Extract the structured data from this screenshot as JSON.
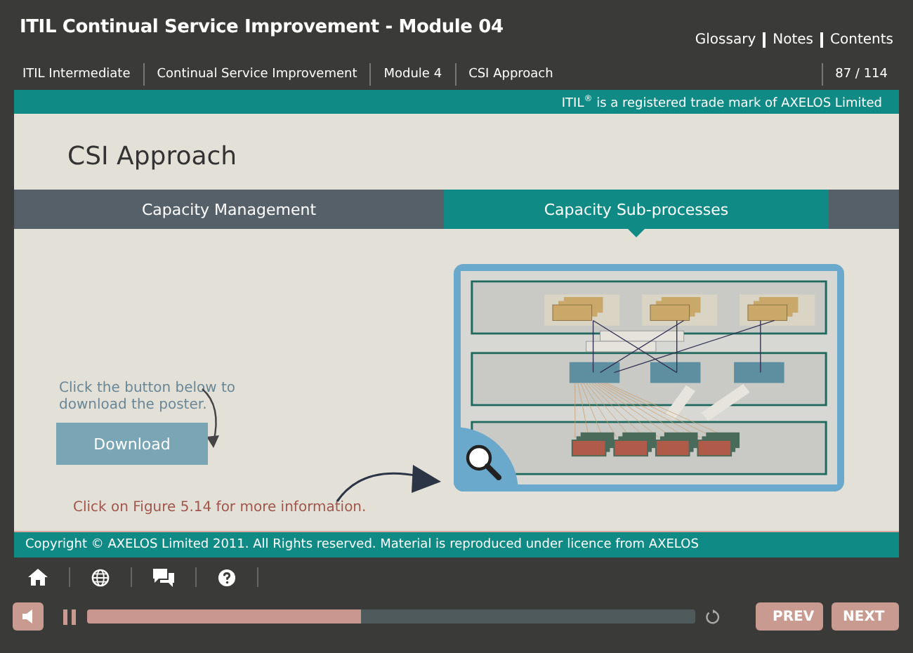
{
  "header": {
    "title": "ITIL Continual Service Improvement - Module 04",
    "links": [
      "Glossary",
      "Notes",
      "Contents"
    ]
  },
  "breadcrumb": {
    "items": [
      "ITIL Intermediate",
      "Continual Service Improvement",
      "Module 4",
      "CSI Approach"
    ],
    "page_counter": "87 / 114"
  },
  "trademark_notice": "ITIL$^{®}$ is a registered trade mark of AXELOS Limited",
  "slide": {
    "heading": "CSI Approach",
    "tabs": [
      {
        "label": "Capacity Management",
        "selected": false
      },
      {
        "label": "Capacity Sub-processes",
        "selected": true
      }
    ],
    "download_hint": "Click the button below to download the poster.",
    "download_button": "Download",
    "figure_hint": "Click on Figure 5.14 for more information."
  },
  "copyright": "Copyright © AXELOS Limited 2011. All Rights reserved. Material is reproduced under licence from AXELOS",
  "player": {
    "progress": {
      "level": 0.45
    },
    "prev": "PREV",
    "next": "NEXT"
  }
}
